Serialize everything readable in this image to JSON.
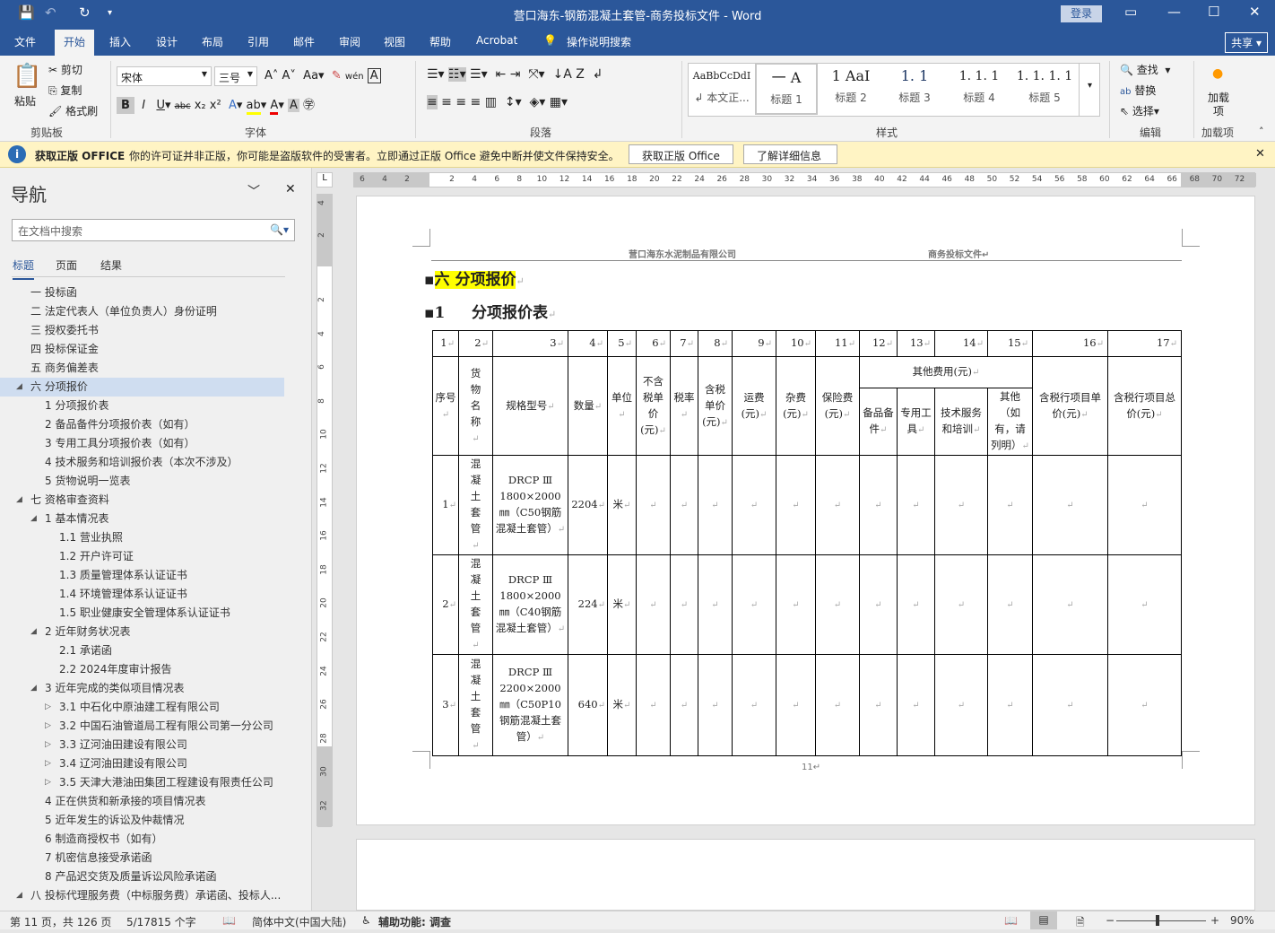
{
  "window": {
    "title": "营口海东-钢筋混凝土套管-商务投标文件 - Word",
    "login": "登录"
  },
  "ribbon_tabs": [
    "文件",
    "开始",
    "插入",
    "设计",
    "布局",
    "引用",
    "邮件",
    "审阅",
    "视图",
    "帮助",
    "Acrobat",
    "操作说明搜索"
  ],
  "share": "共享",
  "clipboard": {
    "paste": "粘贴",
    "cut": "剪切",
    "copy": "复制",
    "format_painter": "格式刷",
    "label": "剪贴板"
  },
  "font": {
    "name": "宋体",
    "size": "三号",
    "label": "字体"
  },
  "paragraph": {
    "label": "段落"
  },
  "styles": {
    "label": "样式",
    "items": [
      {
        "preview": "AaBbCcDdI",
        "name": "↲ 本文正..."
      },
      {
        "preview": "一    A",
        "name": "标题 1"
      },
      {
        "preview": "1   AaI",
        "name": "标题 2"
      },
      {
        "preview": "1. 1",
        "name": "标题 3"
      },
      {
        "preview": "1. 1. 1",
        "name": "标题 4"
      },
      {
        "preview": "1. 1. 1. 1",
        "name": "标题 5"
      }
    ]
  },
  "editing": {
    "find": "查找",
    "replace": "替换",
    "select": "选择",
    "label": "编辑"
  },
  "addins": {
    "button": "加载项",
    "label": "加载项"
  },
  "warning": {
    "title": "获取正版 OFFICE",
    "message": "你的许可证并非正版，你可能是盗版软件的受害者。立即通过正版 Office 避免中断并使文件保持安全。",
    "btn_get": "获取正版 Office",
    "btn_learn": "了解详细信息"
  },
  "nav": {
    "title": "导航",
    "search_placeholder": "在文档中搜索",
    "tabs": [
      "标题",
      "页面",
      "结果"
    ],
    "items": [
      {
        "t": "一 投标函",
        "l": 1,
        "a": ""
      },
      {
        "t": "二 法定代表人（单位负责人）身份证明",
        "l": 1,
        "a": ""
      },
      {
        "t": "三 授权委托书",
        "l": 1,
        "a": ""
      },
      {
        "t": "四 投标保证金",
        "l": 1,
        "a": ""
      },
      {
        "t": "五 商务偏差表",
        "l": 1,
        "a": ""
      },
      {
        "t": "六 分项报价",
        "l": 1,
        "a": "◢",
        "sel": true
      },
      {
        "t": "1 分项报价表",
        "l": 2,
        "a": ""
      },
      {
        "t": "2 备品备件分项报价表（如有）",
        "l": 2,
        "a": ""
      },
      {
        "t": "3 专用工具分项报价表（如有）",
        "l": 2,
        "a": ""
      },
      {
        "t": "4 技术服务和培训报价表（本次不涉及）",
        "l": 2,
        "a": ""
      },
      {
        "t": "5 货物说明一览表",
        "l": 2,
        "a": ""
      },
      {
        "t": "七 资格审查资料",
        "l": 1,
        "a": "◢"
      },
      {
        "t": "1 基本情况表",
        "l": 2,
        "a": "◢"
      },
      {
        "t": "1.1 营业执照",
        "l": 3,
        "a": ""
      },
      {
        "t": "1.2 开户许可证",
        "l": 3,
        "a": ""
      },
      {
        "t": "1.3 质量管理体系认证证书",
        "l": 3,
        "a": ""
      },
      {
        "t": "1.4 环境管理体系认证证书",
        "l": 3,
        "a": ""
      },
      {
        "t": "1.5 职业健康安全管理体系认证证书",
        "l": 3,
        "a": ""
      },
      {
        "t": "2 近年财务状况表",
        "l": 2,
        "a": "◢"
      },
      {
        "t": "2.1 承诺函",
        "l": 3,
        "a": ""
      },
      {
        "t": "2.2 2024年度审计报告",
        "l": 3,
        "a": ""
      },
      {
        "t": "3 近年完成的类似项目情况表",
        "l": 2,
        "a": "◢"
      },
      {
        "t": "3.1 中石化中原油建工程有限公司",
        "l": 3,
        "a": "▷"
      },
      {
        "t": "3.2 中国石油管道局工程有限公司第一分公司",
        "l": 3,
        "a": "▷"
      },
      {
        "t": "3.3 辽河油田建设有限公司",
        "l": 3,
        "a": "▷"
      },
      {
        "t": "3.4 辽河油田建设有限公司",
        "l": 3,
        "a": "▷"
      },
      {
        "t": "3.5 天津大港油田集团工程建设有限责任公司",
        "l": 3,
        "a": "▷"
      },
      {
        "t": "4 正在供货和新承接的项目情况表",
        "l": 2,
        "a": ""
      },
      {
        "t": "5 近年发生的诉讼及仲裁情况",
        "l": 2,
        "a": ""
      },
      {
        "t": "6 制造商授权书（如有）",
        "l": 2,
        "a": ""
      },
      {
        "t": "7 机密信息接受承诺函",
        "l": 2,
        "a": ""
      },
      {
        "t": "8 产品迟交货及质量诉讼风险承诺函",
        "l": 2,
        "a": ""
      },
      {
        "t": "八 投标代理服务费（中标服务费）承诺函、投标人...",
        "l": 1,
        "a": "◢"
      }
    ]
  },
  "ruler": {
    "h": [
      "6",
      "4",
      "2",
      "2",
      "4",
      "6",
      "8",
      "10",
      "12",
      "14",
      "16",
      "18",
      "20",
      "22",
      "24",
      "26",
      "28",
      "30",
      "32",
      "34",
      "36",
      "38",
      "40",
      "42",
      "44",
      "46",
      "48",
      "50",
      "52",
      "54",
      "56",
      "58",
      "60",
      "62",
      "64",
      "66",
      "68",
      "70",
      "72"
    ],
    "v": [
      "4",
      "2",
      "2",
      "4",
      "6",
      "8",
      "10",
      "12",
      "14",
      "16",
      "18",
      "20",
      "22",
      "24",
      "26",
      "28",
      "30",
      "32"
    ]
  },
  "document": {
    "header_left": "营口海东水泥制品有限公司",
    "header_right": "商务投标文件↵",
    "heading1": "六 分项报价",
    "heading2_num": "1",
    "heading2": "分项报价表",
    "page_number": "11↵",
    "table": {
      "col_numbers": [
        "1",
        "2",
        "3",
        "4",
        "5",
        "6",
        "7",
        "8",
        "9",
        "10",
        "11",
        "12",
        "13",
        "14",
        "15",
        "16",
        "17"
      ],
      "headers": [
        "序号",
        "货物名称",
        "规格型号",
        "数量",
        "单位",
        "不含税单价(元)",
        "税率",
        "含税单价(元)",
        "运费(元)",
        "杂费(元)",
        "保险费(元)",
        "含税行项目单价(元)",
        "含税行项目总价(元)"
      ],
      "other_fees": "其他费用(元)",
      "other_sub": [
        "备品备件",
        "专用工具",
        "技术服务和培训",
        "其他（如有，请列明）"
      ],
      "rows": [
        {
          "no": "1",
          "name": "混凝土套管",
          "spec": "DRCP Ⅲ 1800×2000㎜（C50钢筋混凝土套管）",
          "qty": "2204",
          "unit": "米"
        },
        {
          "no": "2",
          "name": "混凝土套管",
          "spec": "DRCP Ⅲ 1800×2000㎜（C40钢筋混凝土套管）",
          "qty": "224",
          "unit": "米"
        },
        {
          "no": "3",
          "name": "混凝土套管",
          "spec": "DRCP Ⅲ 2200×2000㎜（C50P10钢筋混凝土套管）",
          "qty": "640",
          "unit": "米"
        }
      ]
    }
  },
  "status": {
    "page": "第 11 页，共 126 页",
    "words": "5/17815 个字",
    "language": "简体中文(中国大陆)",
    "accessibility": "辅助功能: 调查",
    "zoom": "90%"
  }
}
